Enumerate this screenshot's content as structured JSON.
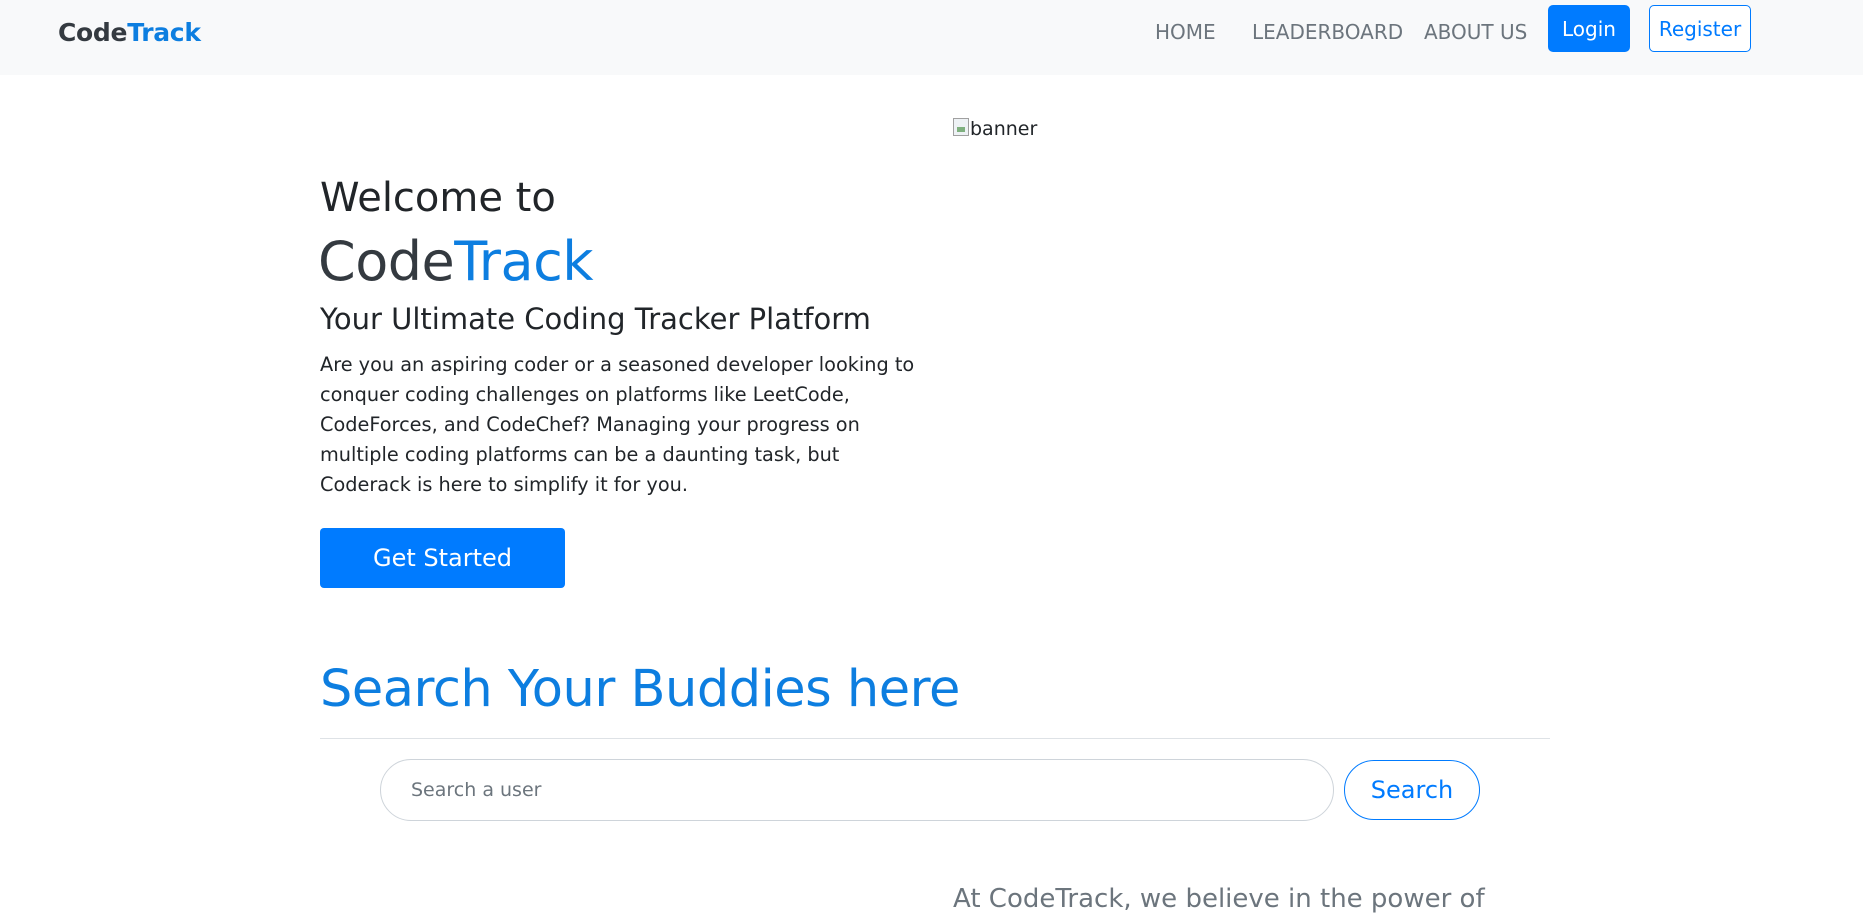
{
  "navbar": {
    "brand_part1": "Code",
    "brand_part2": "Track",
    "links": [
      "HOME",
      "LEADERBOARD",
      "ABOUT US"
    ],
    "login_label": "Login",
    "register_label": "Register"
  },
  "hero": {
    "welcome": "Welcome to",
    "brand_part1": "Code",
    "brand_part2": "Track",
    "subtitle": "Your Ultimate Coding Tracker Platform",
    "description": "Are you an aspiring coder or a seasoned developer looking to conquer coding challenges on platforms like LeetCode, CodeForces, and CodeChef? Managing your progress on multiple coding platforms can be a daunting task, but Coderack is here to simplify it for you.",
    "cta_label": "Get Started"
  },
  "banner": {
    "alt_text": "banner"
  },
  "search": {
    "heading": "Search Your Buddies here",
    "placeholder": "Search a user",
    "button_label": "Search"
  },
  "about": {
    "text": "At CodeTrack, we believe in the power of"
  },
  "colors": {
    "accent": "#0d7ee0",
    "primary_button": "#007bff",
    "navbar_bg": "#f8f9fa"
  }
}
